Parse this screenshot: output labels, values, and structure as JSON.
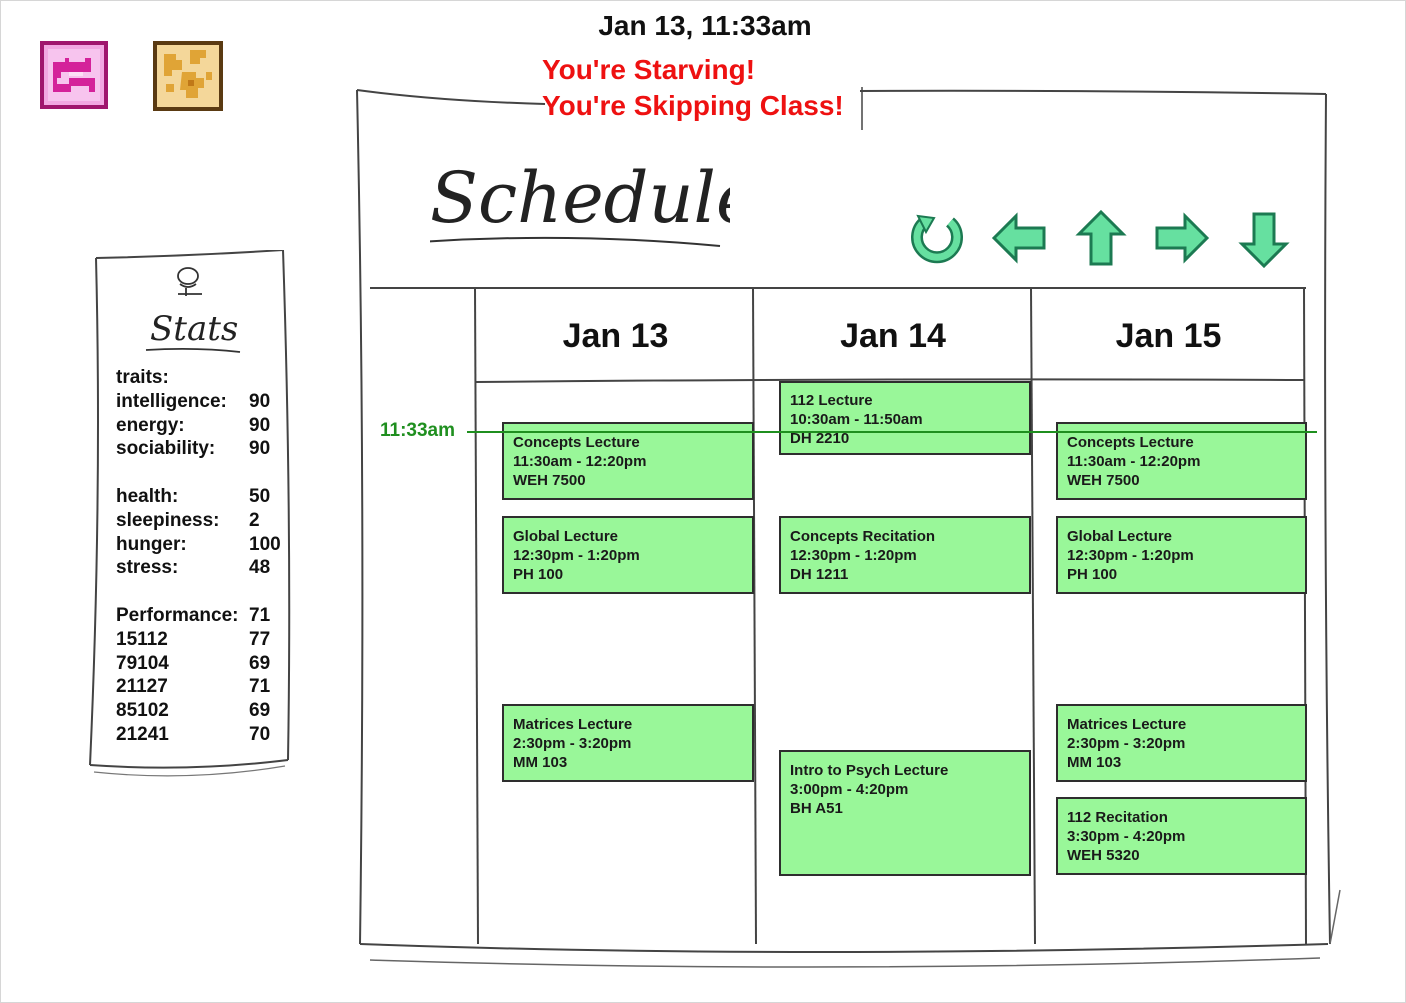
{
  "header": {
    "datetime": "Jan 13, 11:33am",
    "alerts": [
      "You're Starving!",
      "You're Skipping Class!"
    ]
  },
  "toolbar": {
    "bed_icon": "bed-icon",
    "map_icon": "map-icon"
  },
  "stats": {
    "title": "Stats",
    "traits_label": "traits:",
    "traits": [
      {
        "label": "intelligence:",
        "value": "90"
      },
      {
        "label": "energy:",
        "value": "90"
      },
      {
        "label": "sociability:",
        "value": "90"
      }
    ],
    "status": [
      {
        "label": "health:",
        "value": "50"
      },
      {
        "label": "sleepiness:",
        "value": "2"
      },
      {
        "label": "hunger:",
        "value": "100"
      },
      {
        "label": "stress:",
        "value": "48"
      }
    ],
    "performance": {
      "label": "Performance:",
      "value": "71"
    },
    "courses": [
      {
        "label": "15112",
        "value": "77"
      },
      {
        "label": "79104",
        "value": "69"
      },
      {
        "label": "21127",
        "value": "71"
      },
      {
        "label": "85102",
        "value": "69"
      },
      {
        "label": "21241",
        "value": "70"
      }
    ]
  },
  "schedule": {
    "title": "Schedule",
    "nav": [
      "refresh-icon",
      "arrow-left-icon",
      "arrow-up-icon",
      "arrow-right-icon",
      "arrow-down-icon"
    ],
    "now_label": "11:33am",
    "days": [
      {
        "date": "Jan 13",
        "events": [
          {
            "name": "Concepts Lecture",
            "time": "11:30am - 12:20pm",
            "room": "WEH 7500"
          },
          {
            "name": "Global Lecture",
            "time": "12:30pm - 1:20pm",
            "room": "PH 100"
          },
          {
            "name": "Matrices Lecture",
            "time": "2:30pm - 3:20pm",
            "room": "MM 103"
          }
        ]
      },
      {
        "date": "Jan 14",
        "events": [
          {
            "name": "112 Lecture",
            "time": "10:30am - 11:50am",
            "room": "DH 2210"
          },
          {
            "name": "Concepts Recitation",
            "time": "12:30pm - 1:20pm",
            "room": "DH 1211"
          },
          {
            "name": "Intro to Psych Lecture",
            "time": "3:00pm - 4:20pm",
            "room": "BH A51"
          }
        ]
      },
      {
        "date": "Jan 15",
        "events": [
          {
            "name": "Concepts Lecture",
            "time": "11:30am - 12:20pm",
            "room": "WEH 7500"
          },
          {
            "name": "Global Lecture",
            "time": "12:30pm - 1:20pm",
            "room": "PH 100"
          },
          {
            "name": "Matrices Lecture",
            "time": "2:30pm - 3:20pm",
            "room": "MM 103"
          },
          {
            "name": "112 Recitation",
            "time": "3:30pm - 4:20pm",
            "room": "WEH 5320"
          }
        ]
      }
    ]
  },
  "colors": {
    "event_fill": "#99f799",
    "alert": "#ee1111",
    "now_line": "#1f8f1f",
    "nav_icon": "#66e0a0"
  }
}
